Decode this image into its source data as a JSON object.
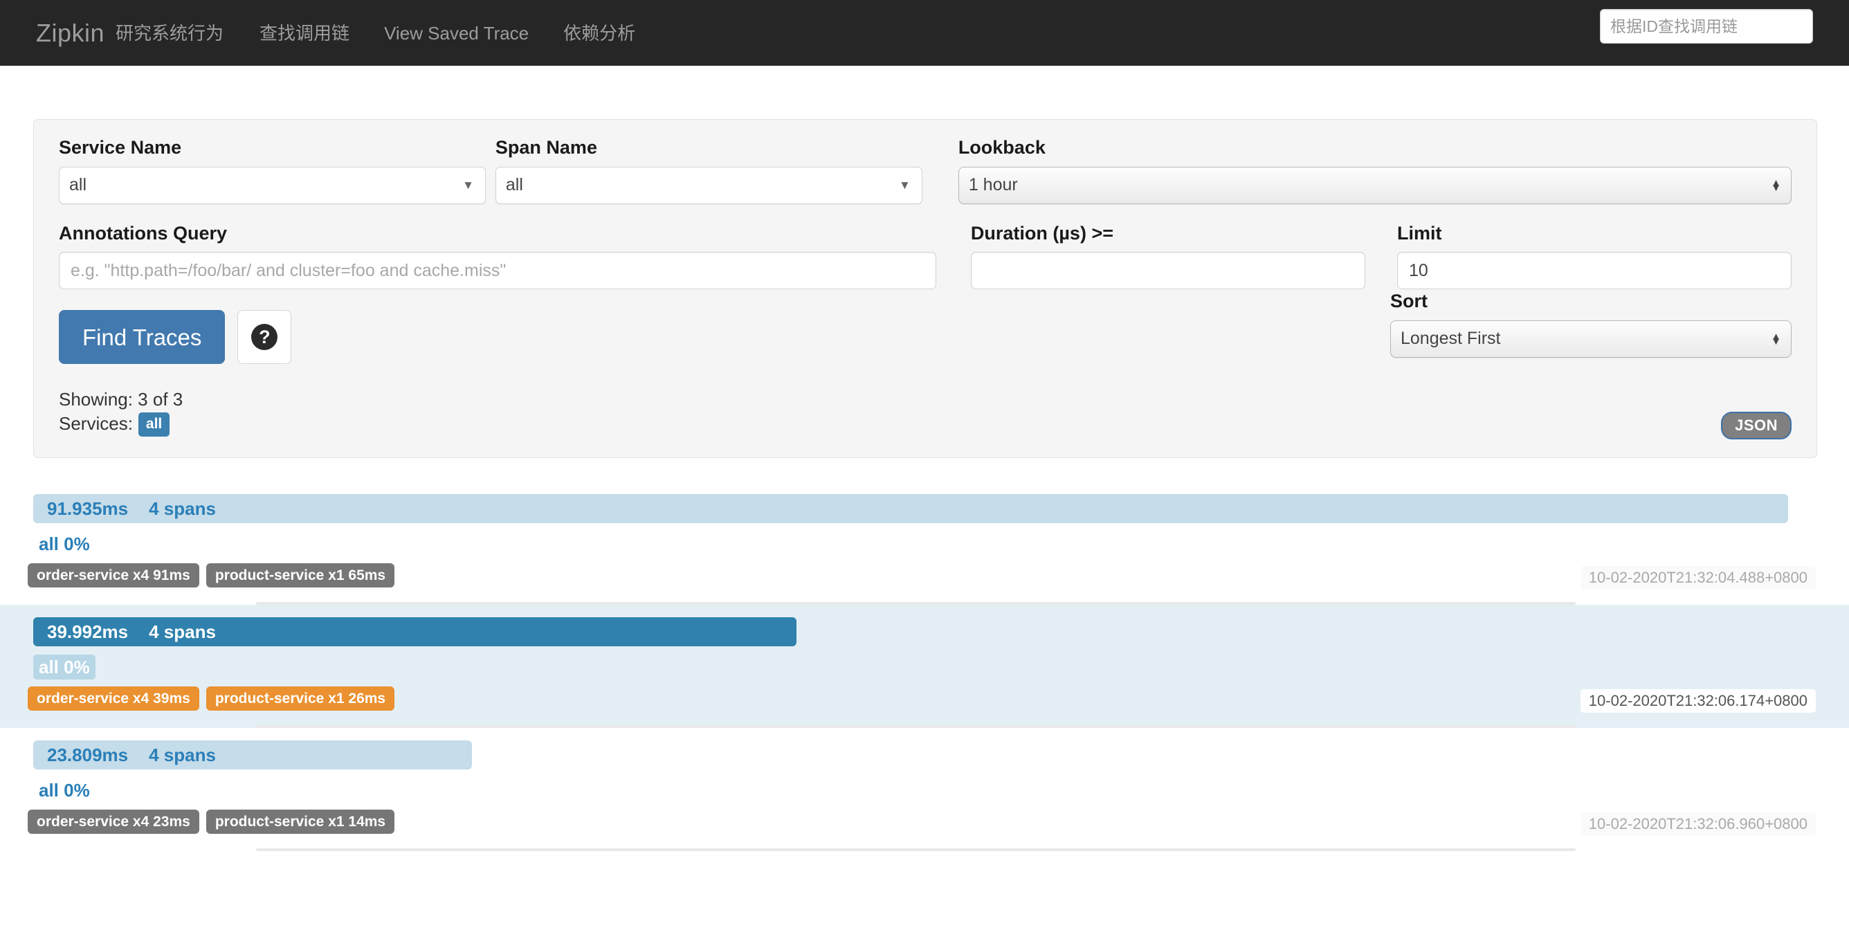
{
  "navbar": {
    "brand": "Zipkin",
    "brand_subtitle": "研究系统行为",
    "links": [
      {
        "label": "查找调用链"
      },
      {
        "label": "View Saved Trace"
      },
      {
        "label": "依赖分析"
      }
    ],
    "search": {
      "placeholder": "根据ID查找调用链",
      "value": ""
    }
  },
  "search_panel": {
    "service_name": {
      "label": "Service Name",
      "value": "all"
    },
    "span_name": {
      "label": "Span Name",
      "value": "all"
    },
    "lookback": {
      "label": "Lookback",
      "value": "1 hour"
    },
    "annotations_query": {
      "label": "Annotations Query",
      "value": "",
      "placeholder": "e.g. \"http.path=/foo/bar/ and cluster=foo and cache.miss\""
    },
    "duration": {
      "label": "Duration (µs) >=",
      "value": "",
      "placeholder": ""
    },
    "limit": {
      "label": "Limit",
      "value": "10"
    },
    "sort": {
      "label": "Sort",
      "value": "Longest First"
    },
    "find_traces_button": "Find Traces",
    "help_icon": "question-mark-icon",
    "showing_text": "Showing: 3 of 3",
    "services_text": "Services:",
    "services_badge": "all",
    "json_button": "JSON",
    "accent_color": "#4279ae",
    "badge_color": "#3c80b0"
  },
  "results": [
    {
      "duration": "91.935ms",
      "spans": "4 spans",
      "percent": "all 0%",
      "bar_width_pct": 100,
      "services": [
        "order-service x4 91ms",
        "product-service x1 65ms"
      ],
      "timestamp": "10-02-2020T21:32:04.488+0800",
      "hovered": false
    },
    {
      "duration": "39.992ms",
      "spans": "4 spans",
      "percent": "all 0%",
      "bar_width_pct": 43.5,
      "services": [
        "order-service x4 39ms",
        "product-service x1 26ms"
      ],
      "timestamp": "10-02-2020T21:32:06.174+0800",
      "hovered": true
    },
    {
      "duration": "23.809ms",
      "spans": "4 spans",
      "percent": "all 0%",
      "bar_width_pct": 25,
      "services": [
        "order-service x4 23ms",
        "product-service x1 14ms"
      ],
      "timestamp": "10-02-2020T21:32:06.960+0800",
      "hovered": false
    }
  ]
}
